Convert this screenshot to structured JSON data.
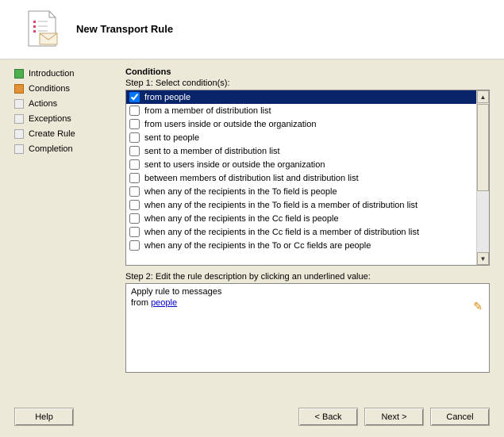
{
  "header": {
    "title": "New Transport Rule"
  },
  "sidebar": {
    "items": [
      {
        "label": "Introduction",
        "icon": "green"
      },
      {
        "label": "Conditions",
        "icon": "orange"
      },
      {
        "label": "Actions",
        "icon": "gray"
      },
      {
        "label": "Exceptions",
        "icon": "gray"
      },
      {
        "label": "Create Rule",
        "icon": "gray"
      },
      {
        "label": "Completion",
        "icon": "gray"
      }
    ]
  },
  "main": {
    "title": "Conditions",
    "step1_label": "Step 1: Select condition(s):",
    "conditions": [
      {
        "label": "from people",
        "checked": true,
        "selected": true
      },
      {
        "label": "from a member of distribution list",
        "checked": false
      },
      {
        "label": "from users inside or outside the organization",
        "checked": false
      },
      {
        "label": "sent to people",
        "checked": false
      },
      {
        "label": "sent to a member of distribution list",
        "checked": false
      },
      {
        "label": "sent to users inside or outside the organization",
        "checked": false
      },
      {
        "label": "between members of distribution list and distribution list",
        "checked": false
      },
      {
        "label": "when any of the recipients in the To field is people",
        "checked": false
      },
      {
        "label": "when any of the recipients in the To field is a member of distribution list",
        "checked": false
      },
      {
        "label": "when any of the recipients in the Cc field is people",
        "checked": false
      },
      {
        "label": "when any of the recipients in the Cc field is a member of distribution list",
        "checked": false
      },
      {
        "label": "when any of the recipients in the To or Cc fields are people",
        "checked": false
      }
    ],
    "step2_label": "Step 2: Edit the rule description by clicking an underlined value:",
    "description": {
      "line1": "Apply rule to messages",
      "line2_prefix": "from ",
      "line2_link": "people"
    }
  },
  "footer": {
    "help": "Help",
    "back": "< Back",
    "next": "Next >",
    "cancel": "Cancel"
  }
}
